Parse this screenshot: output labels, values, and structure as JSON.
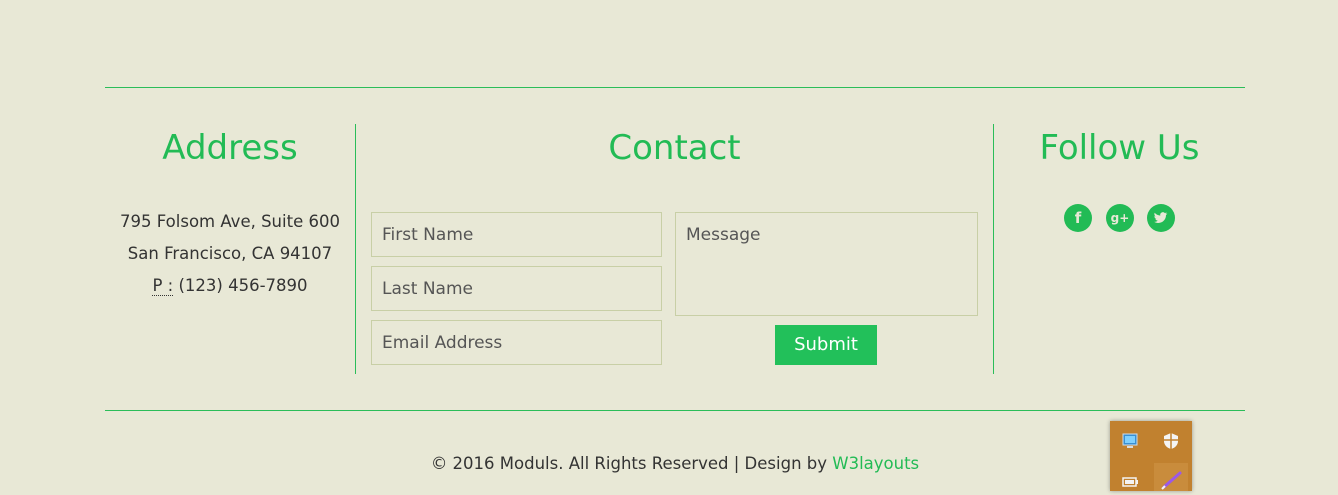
{
  "address": {
    "title": "Address",
    "line1": "795 Folsom Ave, Suite 600",
    "line2": "San Francisco, CA 94107",
    "phone_label": "P :",
    "phone": "(123) 456-7890"
  },
  "contact": {
    "title": "Contact",
    "first_name_placeholder": "First Name",
    "last_name_placeholder": "Last Name",
    "email_placeholder": "Email Address",
    "message_placeholder": "Message",
    "submit_label": "Submit"
  },
  "follow": {
    "title": "Follow Us",
    "icons": [
      "facebook-icon",
      "google-plus-icon",
      "twitter-icon"
    ]
  },
  "footer": {
    "copyright": "© 2016 Moduls. All Rights Reserved | Design by",
    "link": "W3layouts"
  },
  "tray": {
    "icons": [
      "network-icon",
      "security-shield-icon",
      "battery-icon",
      "pen-icon"
    ]
  },
  "colors": {
    "accent": "#22bb55",
    "background": "#e8e8d6",
    "field_border": "#c8cfa6",
    "tray_background": "#c1812f"
  }
}
